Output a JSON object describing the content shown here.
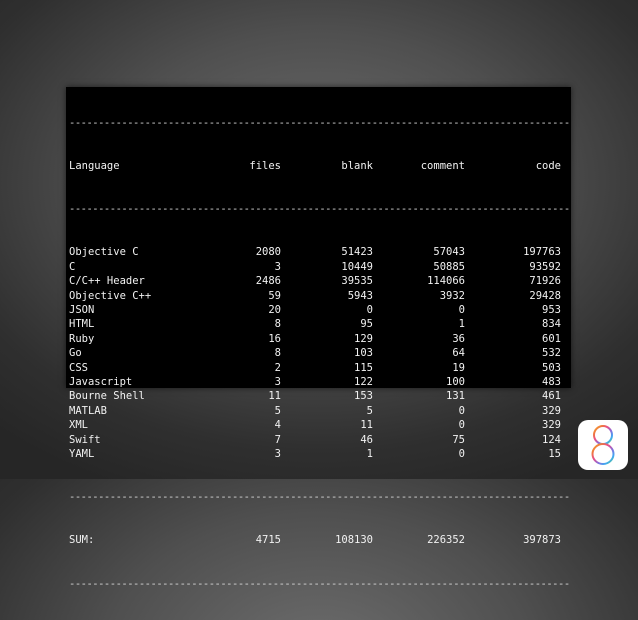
{
  "table": {
    "rule": "-----------------------------------------------------------------------------------------",
    "headers": [
      "Language",
      "files",
      "blank",
      "comment",
      "code"
    ],
    "rows": [
      [
        "Objective C",
        "2080",
        "51423",
        "57043",
        "197763"
      ],
      [
        "C",
        "3",
        "10449",
        "50885",
        "93592"
      ],
      [
        "C/C++ Header",
        "2486",
        "39535",
        "114066",
        "71926"
      ],
      [
        "Objective C++",
        "59",
        "5943",
        "3932",
        "29428"
      ],
      [
        "JSON",
        "20",
        "0",
        "0",
        "953"
      ],
      [
        "HTML",
        "8",
        "95",
        "1",
        "834"
      ],
      [
        "Ruby",
        "16",
        "129",
        "36",
        "601"
      ],
      [
        "Go",
        "8",
        "103",
        "64",
        "532"
      ],
      [
        "CSS",
        "2",
        "115",
        "19",
        "503"
      ],
      [
        "Javascript",
        "3",
        "122",
        "100",
        "483"
      ],
      [
        "Bourne Shell",
        "11",
        "153",
        "131",
        "461"
      ],
      [
        "MATLAB",
        "5",
        "5",
        "0",
        "329"
      ],
      [
        "XML",
        "4",
        "11",
        "0",
        "329"
      ],
      [
        "Swift",
        "7",
        "46",
        "75",
        "124"
      ],
      [
        "YAML",
        "3",
        "1",
        "0",
        "15"
      ]
    ],
    "sum": [
      "SUM:",
      "4715",
      "108130",
      "226352",
      "397873"
    ]
  },
  "logo": {
    "icon": "ios8-logo-icon",
    "glyph": "8",
    "colors": [
      "#f7b33b",
      "#f07a3a",
      "#e94d8a",
      "#8a6bd8",
      "#3fa9f5",
      "#5fd06a"
    ]
  }
}
